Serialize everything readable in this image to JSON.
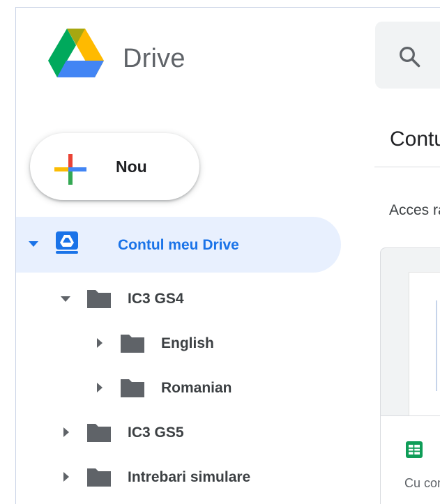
{
  "app": {
    "product_name": "Drive"
  },
  "header": {
    "page_title": "Contul meu Drive",
    "section_label": "Acces rapid"
  },
  "new_button": {
    "label": "Nou"
  },
  "tree": {
    "root": {
      "label": "Contul meu Drive",
      "expanded": true
    },
    "items": [
      {
        "label": "IC3 GS4",
        "expanded": true,
        "level": 1
      },
      {
        "label": "English",
        "expanded": false,
        "level": 2
      },
      {
        "label": "Romanian",
        "expanded": false,
        "level": 2
      },
      {
        "label": "IC3 GS5",
        "expanded": false,
        "level": 1
      },
      {
        "label": "Intrebari simulare",
        "expanded": false,
        "level": 1
      }
    ]
  },
  "file_card": {
    "meta": "Cu comandă",
    "icon": "google-sheets-icon"
  },
  "icons": {
    "logo": "google-drive-logo",
    "search": "search-icon",
    "new": "plus-icon",
    "drive": "my-drive-icon",
    "folder": "folder-icon"
  },
  "colors": {
    "accent": "#1a73e8",
    "selected_bg": "#e8f0fe",
    "folder": "#5f6368",
    "text": "#3c4043"
  }
}
